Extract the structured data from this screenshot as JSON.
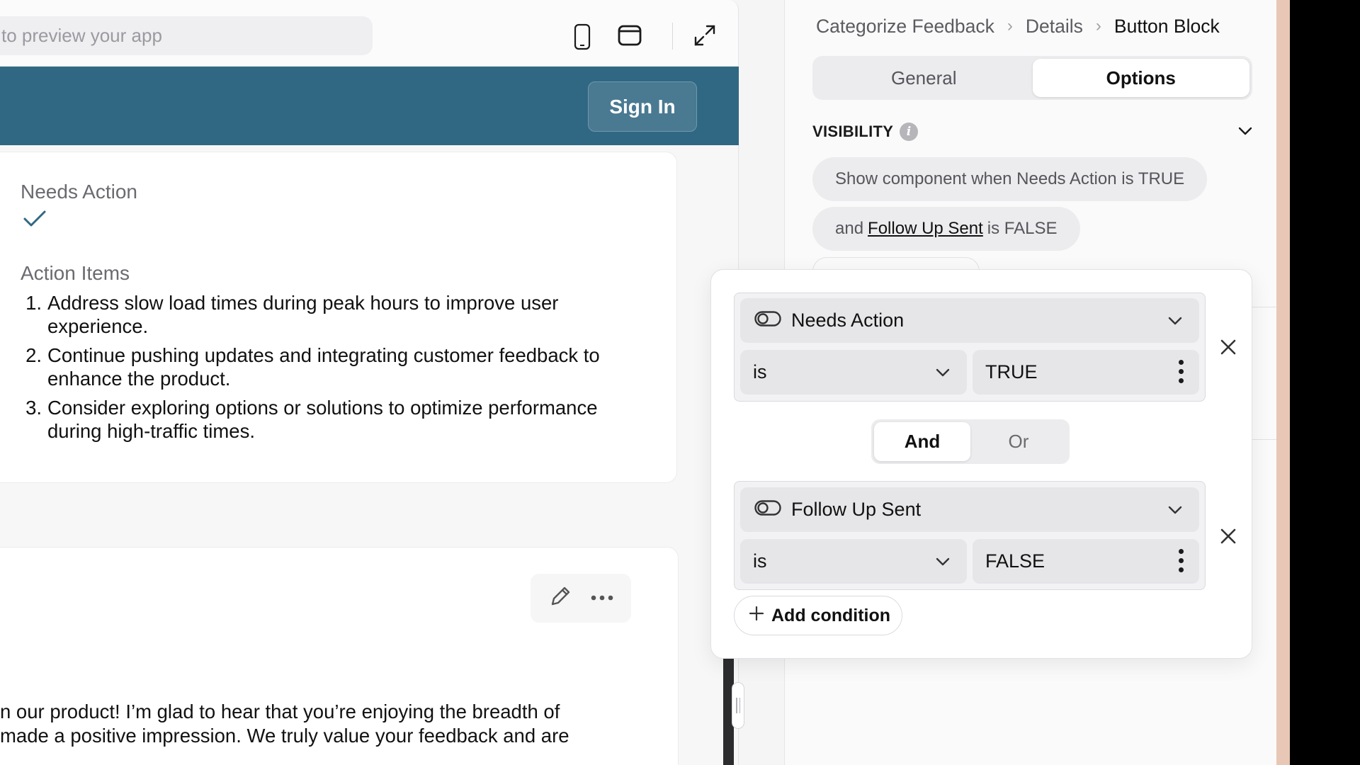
{
  "preview": {
    "url_placeholder": "to preview your app",
    "header": {
      "signin_label": "Sign In",
      "color": "#306883"
    },
    "record": {
      "needs_action_label": "Needs Action",
      "action_items_label": "Action Items",
      "action_items": [
        {
          "num": "1.",
          "text": "Address slow load times during peak hours to improve user experience."
        },
        {
          "num": "2.",
          "text": "Continue pushing updates and integrating customer feedback to enhance the product."
        },
        {
          "num": "3.",
          "text": "Consider exploring options or solutions to optimize performance during high-traffic times."
        }
      ]
    },
    "message": {
      "line1": "n our product! I’m glad to hear that you’re enjoying the breadth of",
      "line2": "made a positive impression. We truly value your feedback and are"
    }
  },
  "properties": {
    "breadcrumb": {
      "item1": "Categorize Feedback",
      "item2": "Details",
      "current": "Button Block"
    },
    "tabs": {
      "general": "General",
      "options": "Options",
      "active": "Options"
    },
    "visibility": {
      "title": "VISIBILITY",
      "summary_line1": "Show component when Needs Action is TRUE",
      "summary_and": "and",
      "summary_field2": "Follow Up Sent",
      "summary_tail": "is FALSE"
    }
  },
  "popover": {
    "conditions": [
      {
        "field": "Needs Action",
        "operator": "is",
        "value": "TRUE"
      },
      {
        "field": "Follow Up Sent",
        "operator": "is",
        "value": "FALSE"
      }
    ],
    "combinator": {
      "and": "And",
      "or": "Or",
      "active": "And"
    },
    "add_condition_label": "Add condition"
  }
}
